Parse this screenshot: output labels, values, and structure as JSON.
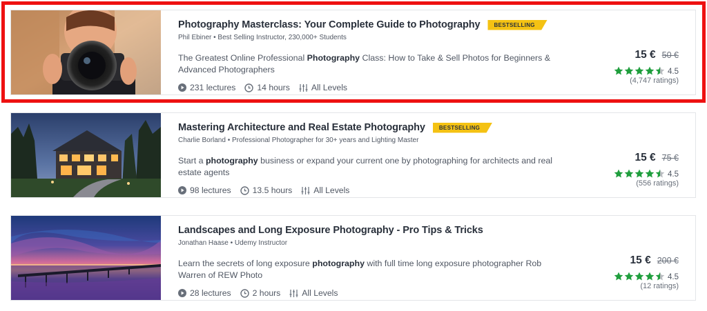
{
  "colors": {
    "star": "#1f9e3d",
    "star_empty": "#b9bcc0",
    "badge": "#f4c213",
    "highlight": "#ee1111"
  },
  "courses": [
    {
      "title": "Photography Masterclass: Your Complete Guide to Photography",
      "badge": "BESTSELLING",
      "instructor": "Phil Ebiner • Best Selling Instructor, 230,000+ Students",
      "desc_pre": "The Greatest Online Professional ",
      "desc_bold": "Photography",
      "desc_post": " Class: How to Take & Sell Photos for Beginners & Advanced Photographers",
      "lectures": "231 lectures",
      "hours": "14 hours",
      "level": "All Levels",
      "price": "15 €",
      "old_price": "50 €",
      "rating": 4.5,
      "rating_text": "4.5",
      "ratings_count": "(4,747 ratings)",
      "thumbnail_icon": "photographer-with-camera-image"
    },
    {
      "title": "Mastering Architecture and Real Estate Photography",
      "badge": "BESTSELLING",
      "instructor": "Charlie Borland • Professional Photographer for 30+ years and Lighting Master",
      "desc_pre": "Start a ",
      "desc_bold": "photography",
      "desc_post": " business or expand your current one by photographing for architects and real estate agents",
      "lectures": "98 lectures",
      "hours": "13.5 hours",
      "level": "All Levels",
      "price": "15 €",
      "old_price": "75 €",
      "rating": 4.5,
      "rating_text": "4.5",
      "ratings_count": "(556 ratings)",
      "thumbnail_icon": "house-at-dusk-image"
    },
    {
      "title": "Landscapes and Long Exposure Photography - Pro Tips & Tricks",
      "badge": "",
      "instructor": "Jonathan Haase • Udemy Instructor",
      "desc_pre": "Learn the secrets of long exposure ",
      "desc_bold": "photography",
      "desc_post": " with full time long exposure photographer Rob Warren of REW Photo",
      "lectures": "28 lectures",
      "hours": "2 hours",
      "level": "All Levels",
      "price": "15 €",
      "old_price": "200 €",
      "rating": 4.5,
      "rating_text": "4.5",
      "ratings_count": "(12 ratings)",
      "thumbnail_icon": "sunset-lake-pier-image"
    }
  ]
}
